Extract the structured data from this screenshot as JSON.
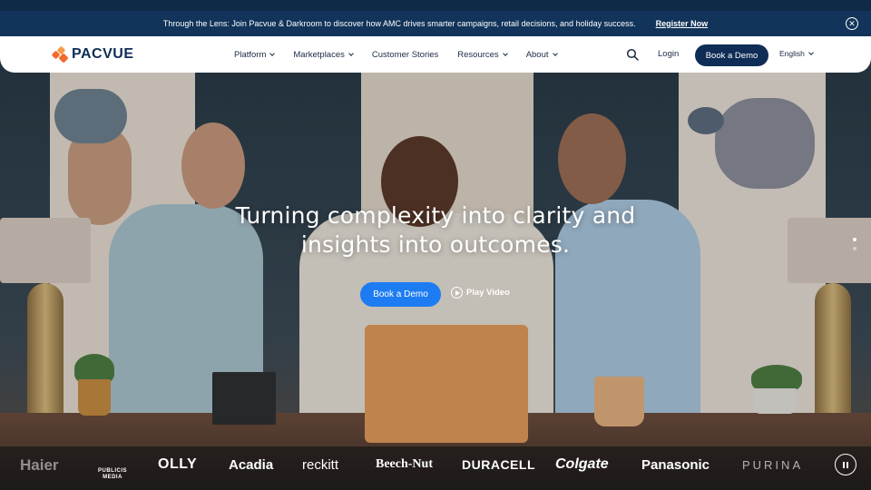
{
  "announcement": {
    "message": "Through the Lens: Join Pacvue & Darkroom to discover how AMC drives smarter campaigns, retail decisions, and holiday success.",
    "cta": "Register Now"
  },
  "nav": {
    "logo_text": "PACVUE",
    "menu": [
      {
        "label": "Platform",
        "dropdown": true
      },
      {
        "label": "Marketplaces",
        "dropdown": true
      },
      {
        "label": "Customer Stories",
        "dropdown": false
      },
      {
        "label": "Resources",
        "dropdown": true
      },
      {
        "label": "About",
        "dropdown": true
      }
    ],
    "login": "Login",
    "demo": "Book a Demo",
    "language": "English"
  },
  "hero": {
    "title_line1": "Turning complexity into clarity and",
    "title_line2": "insights into outcomes.",
    "demo": "Book a Demo",
    "play": "Play Video"
  },
  "brands": [
    "Haier",
    "PUBLICIS MEDIA",
    "OLLY",
    "Acadia",
    "reckitt",
    "Beech-Nut",
    "DURACELL",
    "Colgate",
    "Panasonic",
    "PURINA"
  ],
  "colors": {
    "navy": "#0f2d57",
    "announce_bg": "#12345a",
    "accent_blue": "#1d7cf2",
    "logo_orange": "#f26a2e"
  }
}
